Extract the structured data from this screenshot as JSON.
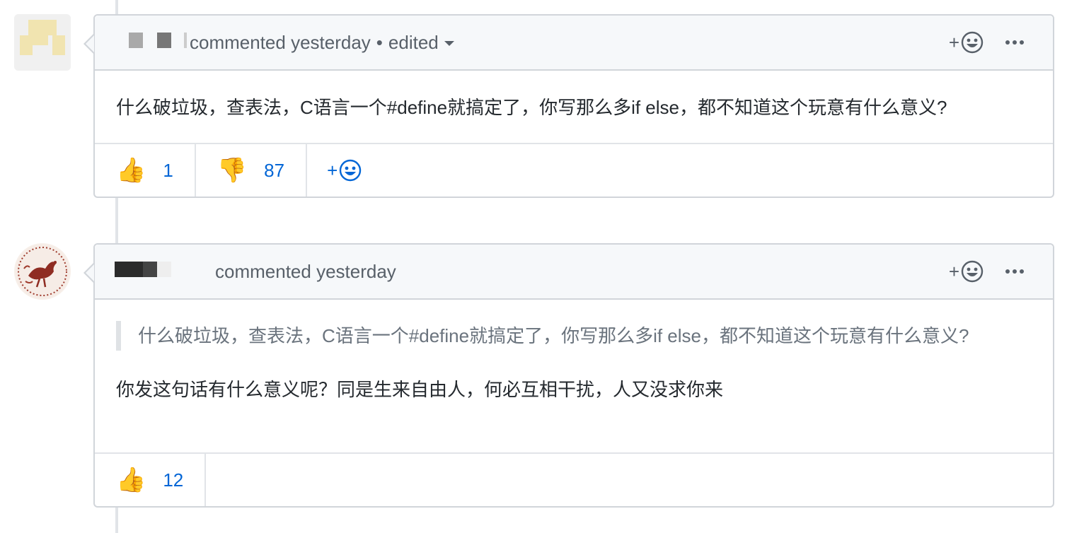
{
  "colors": {
    "border": "#d1d5da",
    "header_bg": "#f6f8fa",
    "link_blue": "#0366d6",
    "meta_gray": "#586069"
  },
  "comments": [
    {
      "header": {
        "meta_text": "commented yesterday",
        "separator": "•",
        "edited_label": "edited"
      },
      "body": "什么破垃圾，查表法，C语言一个#define就搞定了，你写那么多if else，都不知道这个玩意有什么意义?",
      "reactions": [
        {
          "emoji": "👍",
          "icon": "thumbs-up-icon",
          "count": "1"
        },
        {
          "emoji": "👎",
          "icon": "thumbs-down-icon",
          "count": "87"
        }
      ],
      "add_reaction_label": "+"
    },
    {
      "header": {
        "meta_text": "commented yesterday"
      },
      "quote": "什么破垃圾，查表法，C语言一个#define就搞定了，你写那么多if else，都不知道这个玩意有什么意义?",
      "body": "你发这句话有什么意义呢？同是生来自由人，何必互相干扰，人又没求你来",
      "reactions": [
        {
          "emoji": "👍",
          "icon": "thumbs-up-icon",
          "count": "12"
        }
      ]
    }
  ],
  "header_actions": {
    "add_reaction_label": "+",
    "more_icon": "kebab-horizontal-icon",
    "smiley_icon": "smiley-icon"
  }
}
